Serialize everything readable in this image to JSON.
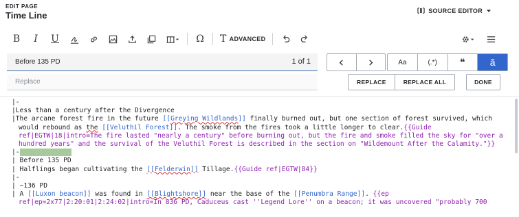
{
  "header": {
    "edit_label": "EDIT PAGE",
    "page_title": "Time Line",
    "source_editor_label": "SOURCE EDITOR"
  },
  "toolbar": {
    "bold": "B",
    "italic": "I",
    "underline": "U",
    "advanced": "ADVANCED",
    "icons": [
      "bold-icon",
      "italic-icon",
      "underline-icon",
      "signature-icon",
      "link-icon",
      "image-icon",
      "upload-icon",
      "gallery-icon",
      "citation-icon",
      "special-character-icon",
      "advanced-text-icon",
      "undo-icon",
      "redo-icon",
      "settings-icon",
      "menu-icon"
    ]
  },
  "find": {
    "value": "Before 135 PD",
    "count": "1 of 1",
    "options": {
      "match_case": "Aa",
      "regex": "(.*)",
      "quote": "❝",
      "diacritic": "ã"
    }
  },
  "replace": {
    "placeholder": "Replace",
    "replace_label": "REPLACE",
    "replace_all_label": "REPLACE ALL",
    "done_label": "DONE"
  },
  "colors": {
    "accent": "#3366cc",
    "template": "#8d20ae",
    "match_highlight": "#a8c99c"
  },
  "source": {
    "l1": "|-",
    "l2": "|Less than a century after the Divergence",
    "l3a": "|The arcane forest fire in the future ",
    "l3b": "[[Greying Wildlands]]",
    "l3c": " finally burned out, but one section of forest survived, which would rebound as ",
    "l3d": "the",
    "l3e": " ",
    "l3f": "[[Veluthil Forest]]",
    "l3g": ". The smoke from the fires took a little longer to clear.",
    "l3h": "{{Guide ref|EGTW|18|intro=The fire lasted \"nearly a century\" before burning out, but the fire and smoke filled the sky for \"over a hundred years\" and the survival of the Veluthil Forest is described in the section on \"Wildemount After the Calamity.\"}}",
    "l4": "|-",
    "l5": "| Before 135 PD",
    "l6a": "| Halflings began cultivating the ",
    "l6b": "[[Felderwin]]",
    "l6c": " Tillage.",
    "l6d": "{{Guide ref|EGTW|84}}",
    "l7": "|-",
    "l8": "| ~136 PD",
    "l9a": "| A ",
    "l9b": "[[Luxon beacon]]",
    "l9c": " was found in ",
    "l9d": "[[Blightshore]]",
    "l9e": " near the base of the ",
    "l9f": "[[Penumbra Range]]",
    "l9g": ". ",
    "l9h": "{{ep ref|ep=2x77|2:20:01|2:24:02|intro=In 836 PD, Caduceus cast ''Legend Lore'' on a beacon; it was uncovered \"probably 700"
  }
}
